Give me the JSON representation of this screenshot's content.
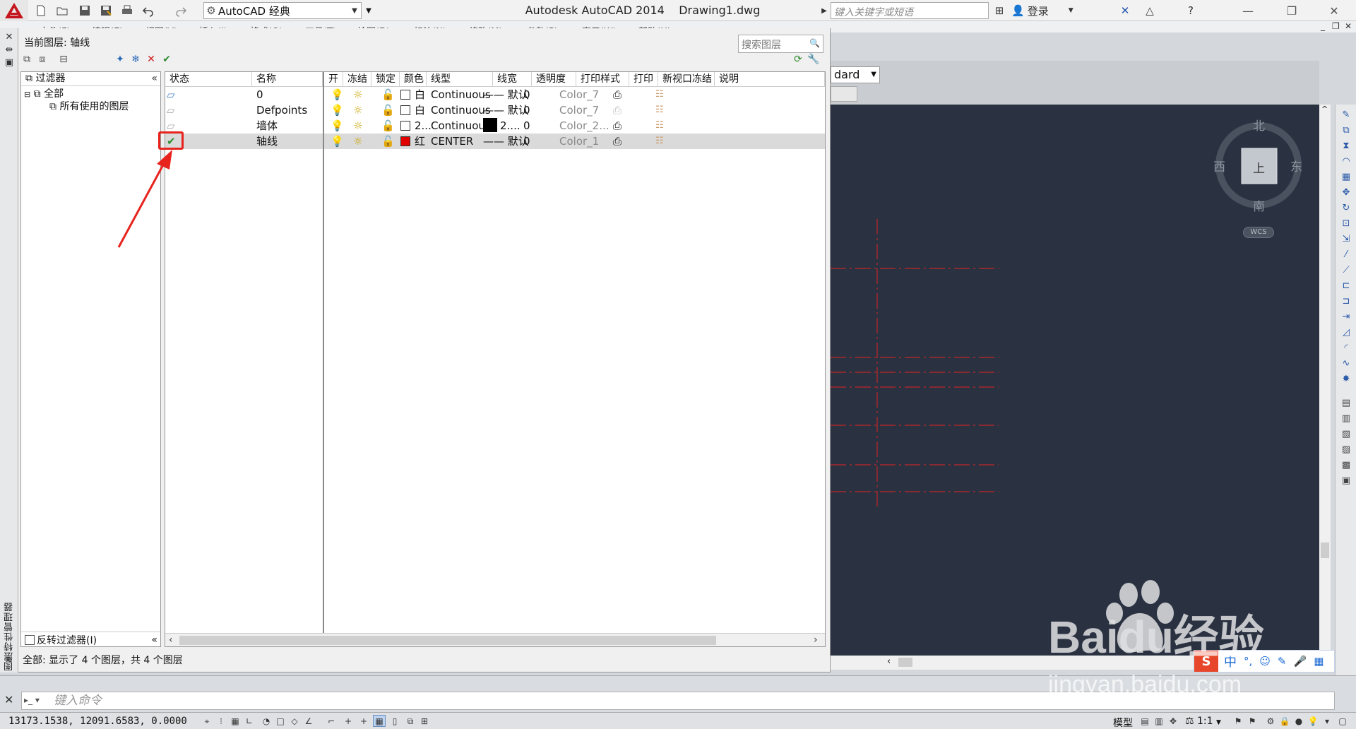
{
  "titlebar": {
    "workspace": "AutoCAD 经典",
    "app_title": "Autodesk AutoCAD 2014",
    "doc_title": "Drawing1.dwg",
    "search_placeholder": "键入关键字或短语",
    "login": "登录"
  },
  "menubar": {
    "items": [
      "文件(F)",
      "编辑(E)",
      "视图(V)",
      "插入(I)",
      "格式(O)",
      "工具(T)",
      "绘图(D)",
      "标注(N)",
      "修改(M)",
      "参数(P)",
      "窗口(W)",
      "帮助(H)"
    ]
  },
  "panel": {
    "vertical_title": "图层特性管理器",
    "current_layer": "当前图层: 轴线",
    "search_placeholder": "搜索图层",
    "filter_header": "过滤器",
    "tree_all": "全部",
    "tree_used": "所有使用的图层",
    "invert_filter": "反转过滤器(I)",
    "status": "全部: 显示了 4 个图层，共 4 个图层"
  },
  "layer_table": {
    "headers": [
      "状态",
      "名称",
      "开",
      "冻结",
      "锁定",
      "颜色",
      "线型",
      "线宽",
      "透明度",
      "打印样式",
      "打印",
      "新视口冻结",
      "说明"
    ],
    "rows": [
      {
        "name": "0",
        "color": "白",
        "color_hex": "#ffffff",
        "linetype": "Continuous",
        "lineweight": "默认",
        "transparency": "0",
        "plot_style": "Color_7",
        "current": false
      },
      {
        "name": "Defpoints",
        "color": "白",
        "color_hex": "#ffffff",
        "linetype": "Continuous",
        "lineweight": "默认",
        "transparency": "0",
        "plot_style": "Color_7",
        "current": false
      },
      {
        "name": "墙体",
        "color": "2...",
        "color_hex": "#ffffff",
        "linetype": "Continuous",
        "lineweight": "2....",
        "transparency": "0",
        "plot_style": "Color_2...",
        "current": false
      },
      {
        "name": "轴线",
        "color": "红",
        "color_hex": "#e00000",
        "linetype": "CENTER",
        "lineweight": "默认",
        "transparency": "0",
        "plot_style": "Color_1",
        "current": true
      }
    ]
  },
  "drawing": {
    "style_combo": "dard",
    "compass": {
      "north": "北",
      "south": "南",
      "east": "东",
      "west": "西",
      "top": "上"
    },
    "wcs": "WCS",
    "background": "#2a3140",
    "axis_color": "#c0262a"
  },
  "command": {
    "placeholder": "键入命令"
  },
  "statusbar": {
    "coords": "13173.1538,  12091.6583,  0.0000",
    "model": "模型",
    "scale": "1:1"
  },
  "watermark": {
    "brand": "Baidu经验",
    "url": "jingyan.baidu.com"
  },
  "ime": {
    "label": "中"
  },
  "accent": "#e8231e"
}
